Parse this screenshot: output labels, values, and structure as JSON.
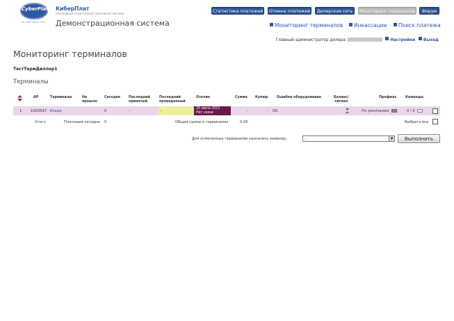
{
  "brand": {
    "logo_text": "CyberPlat",
    "logo_sub": "ON-LINE SINCE 1997",
    "name": "КиберПлат",
    "tagline": "КРУПНЕЙШАЯ ЭЛЕКТРОННАЯ ПЛАТЕЖНАЯ СИСТЕМА",
    "system_title": "Демонстрационная система"
  },
  "top_buttons": [
    "Статистика платежей",
    "Отмена платежей",
    "Дилерская сеть",
    "Мониторинг терминалов",
    "Форум"
  ],
  "nav": [
    "Мониторинг терминалов",
    "Инкассации",
    "Поиск платежа"
  ],
  "userline": {
    "prefix": "Главный администратор дилера:",
    "settings": "Настройки",
    "logout": "Выход"
  },
  "page": {
    "heading": "Мониторинг терминалов",
    "dealer": "ТестТермДиллер1",
    "section": "Терминалы"
  },
  "table": {
    "headers": {
      "ap": "АР",
      "terminals": "Терминалы",
      "not_passed_1": "Не",
      "not_passed_2": "прошло",
      "today": "Сегодня",
      "last_received_1": "Последний",
      "last_received_2": "принятый",
      "last_done_1": "Последний",
      "last_done_2": "проведенный",
      "response": "Отклик",
      "sum": "Сумма",
      "bills": "Купюр",
      "errors": "Ошибки оборудования",
      "balance_1": "Баланс/",
      "balance_2": "сигнал",
      "profile": "Профиль",
      "commands": "Команды"
    },
    "row": {
      "num": "1",
      "ap": "1003547",
      "terminal": "Искра",
      "today": "0",
      "last_received": "-",
      "last_done": "-",
      "response_date": "25 июля 2011",
      "response_status": "Нет связи",
      "sum": "-",
      "bills": "-",
      "errors": "OK",
      "profile": "По умолчанию",
      "commands": "0 / 0"
    },
    "totals": {
      "label": "Итого",
      "payments_today_label": "Платежей сегодня",
      "payments_today": "0",
      "total_label": "Общая сумма в терминалах",
      "total_sum": "0,00",
      "select_all": "Выбрать все"
    }
  },
  "command": {
    "label": "Для отмеченных терминалов назначить команду:",
    "select_value": "...",
    "execute": "Выполнить"
  },
  "colors": {
    "accent": "#2b5391",
    "row_bg": "#ead6ea",
    "last_cell": "#efef9a",
    "response_cell": "#6a1a4a"
  }
}
